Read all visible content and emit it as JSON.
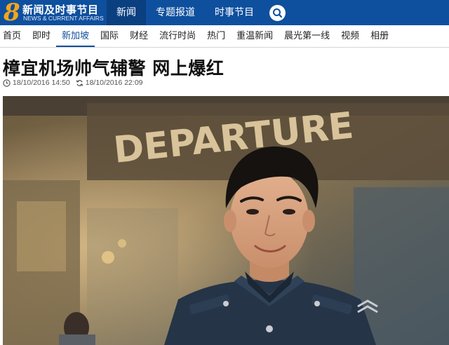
{
  "brand": {
    "logo_numeral": "8",
    "title": "新闻及时事节目",
    "subtitle": "NEWS & CURRENT AFFAIRS"
  },
  "top_nav": {
    "items": [
      {
        "label": "新闻",
        "active": true
      },
      {
        "label": "专题报道",
        "active": false
      },
      {
        "label": "时事节目",
        "active": false
      }
    ],
    "search_icon": "search-icon"
  },
  "sub_nav": {
    "items": [
      {
        "label": "首页",
        "active": false
      },
      {
        "label": "即时",
        "active": false
      },
      {
        "label": "新加坡",
        "active": true
      },
      {
        "label": "国际",
        "active": false
      },
      {
        "label": "财经",
        "active": false
      },
      {
        "label": "流行时尚",
        "active": false
      },
      {
        "label": "热门",
        "active": false
      },
      {
        "label": "重温新闻",
        "active": false
      },
      {
        "label": "晨光第一线",
        "active": false
      },
      {
        "label": "视频",
        "active": false
      },
      {
        "label": "相册",
        "active": false
      }
    ]
  },
  "article": {
    "headline": "樟宜机场帅气辅警 网上爆红",
    "published": "18/10/2016 14:50",
    "updated": "18/10/2016 22:09",
    "published_icon": "clock-icon",
    "updated_icon": "refresh-icon",
    "photo_sign_text": "DEPARTURE"
  },
  "colors": {
    "brand_blue": "#0e4f9e",
    "active_tab": "#0a3f80",
    "logo_orange": "#f4a51c"
  }
}
